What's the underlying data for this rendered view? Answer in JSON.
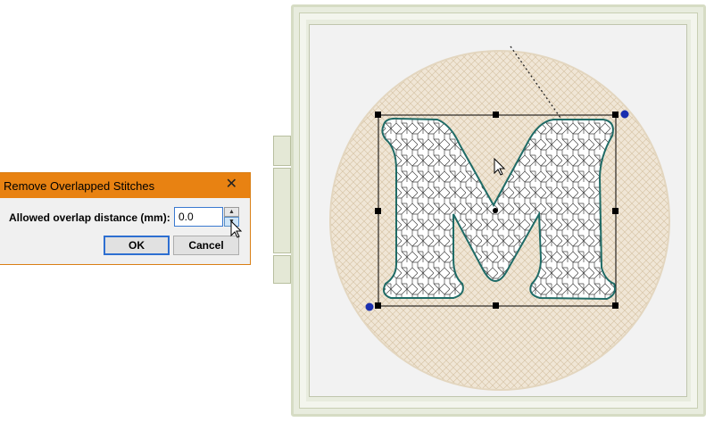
{
  "dialog": {
    "title": "Remove Overlapped Stitches",
    "field_label": "Allowed overlap distance (mm):",
    "field_value": "0.0",
    "ok_label": "OK",
    "cancel_label": "Cancel",
    "close_glyph": "✕"
  },
  "icons": {
    "close": "close-icon",
    "spin_up": "chevron-up-icon",
    "spin_down": "chevron-down-icon",
    "cursor": "mouse-pointer-icon"
  },
  "colors": {
    "title_bar": "#e88212",
    "fill_circle": "#f0e6d6",
    "letter_outline": "#1f6b66",
    "handle": "#000000",
    "rotate_handle": "#1a2fb0"
  },
  "canvas": {
    "design_letter": "M"
  }
}
